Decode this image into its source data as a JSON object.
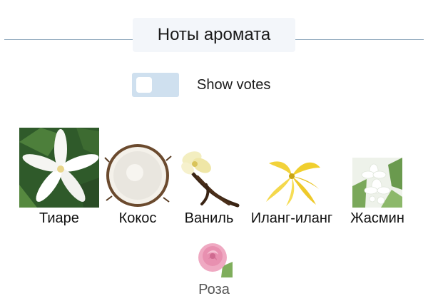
{
  "section": {
    "title": "Ноты аромата"
  },
  "toggle": {
    "label": "Show votes",
    "on": false
  },
  "notes": [
    {
      "label": "Тиаре",
      "icon": "tiare-flower-icon"
    },
    {
      "label": "Кокос",
      "icon": "coconut-icon"
    },
    {
      "label": "Ваниль",
      "icon": "vanilla-icon"
    },
    {
      "label": "Иланг-иланг",
      "icon": "ylang-ylang-icon"
    },
    {
      "label": "Жасмин",
      "icon": "jasmine-icon"
    },
    {
      "label": "Роза",
      "icon": "rose-icon"
    }
  ],
  "colors": {
    "rule": "#8fa8bd",
    "title_bg": "#f3f6fa",
    "toggle_bg": "#cfe0ef"
  }
}
